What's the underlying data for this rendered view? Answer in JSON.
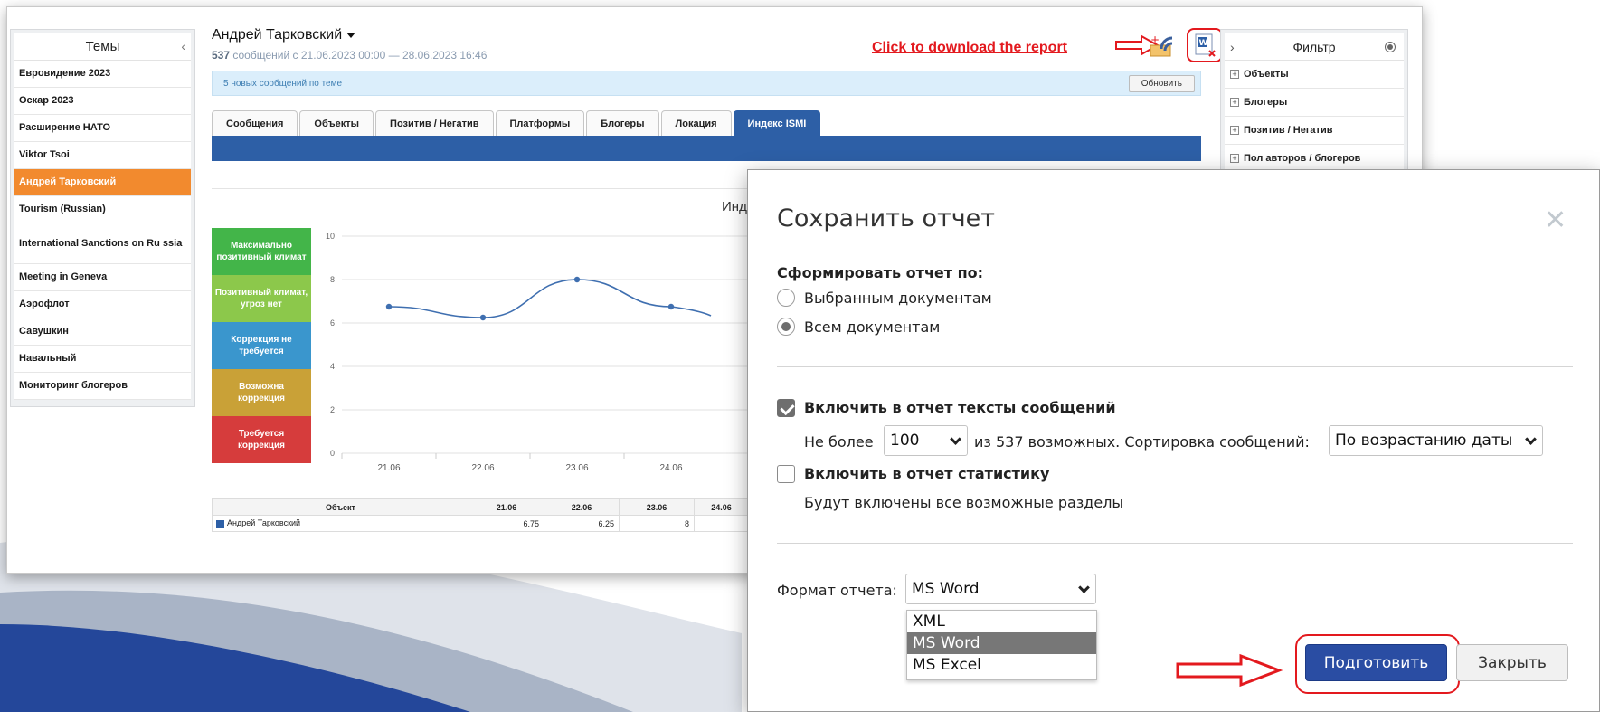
{
  "themes": {
    "title": "Темы",
    "items": [
      {
        "label": "Евровидение 2023"
      },
      {
        "label": "Оскар 2023"
      },
      {
        "label": "Расширение НАТО"
      },
      {
        "label": "Viktor Tsoi"
      },
      {
        "label": "Андрей Тарковский"
      },
      {
        "label": "Tourism (Russian)"
      },
      {
        "label": "International Sanctions on Ru ssia"
      },
      {
        "label": "Meeting in Geneva"
      },
      {
        "label": "Аэрофлот"
      },
      {
        "label": "Савушкин"
      },
      {
        "label": "Навальный"
      },
      {
        "label": "Мониторинг блогеров"
      }
    ]
  },
  "header": {
    "title": "Андрей Тарковский",
    "count": "537",
    "sub_prefix": "сообщений с",
    "date_range": "21.06.2023 00:00 — 28.06.2023 16:46",
    "download_annotation": "Click to download the report"
  },
  "notice": {
    "text": "5 новых сообщений по теме",
    "refresh_label": "Обновить"
  },
  "tabs": [
    {
      "label": "Сообщения"
    },
    {
      "label": "Объекты"
    },
    {
      "label": "Позитив / Негатив"
    },
    {
      "label": "Платформы"
    },
    {
      "label": "Блогеры"
    },
    {
      "label": "Локация"
    },
    {
      "label": "Индекс ISMI"
    }
  ],
  "chart_title_partial": "Инде",
  "legend": [
    {
      "label": "Максимально позитивный климат",
      "color": "#43b549"
    },
    {
      "label": "Позитивный климат, угроз нет",
      "color": "#8cc84b"
    },
    {
      "label": "Коррекция не требуется",
      "color": "#3a96cd"
    },
    {
      "label": "Возможна коррекция",
      "color": "#c9a137"
    },
    {
      "label": "Требуется коррекция",
      "color": "#d63c3c"
    }
  ],
  "chart_data": {
    "type": "line",
    "x": [
      "21.06",
      "22.06",
      "23.06",
      "24.06"
    ],
    "series": [
      {
        "name": "Андрей Тарковский",
        "values": [
          6.75,
          6.25,
          8,
          6.75
        ]
      }
    ],
    "ylim": [
      0,
      10
    ],
    "yticks": [
      "0",
      "2",
      "4",
      "6",
      "8",
      "10"
    ],
    "grid": true,
    "color": "#3f6fb0"
  },
  "table": {
    "headers": [
      "Объект",
      "21.06",
      "22.06",
      "23.06",
      "24.06"
    ],
    "rows": [
      {
        "object": "Андрей Тарковский",
        "values": [
          "6.75",
          "6.25",
          "8",
          ""
        ]
      }
    ]
  },
  "filter": {
    "title": "Фильтр",
    "items": [
      {
        "label": "Объекты"
      },
      {
        "label": "Блогеры"
      },
      {
        "label": "Позитив / Негатив"
      },
      {
        "label": "Пол авторов / блогеров"
      }
    ]
  },
  "modal": {
    "title": "Сохранить отчет",
    "form_label": "Сформировать отчет по:",
    "radio_selected_docs": "Выбранным документам",
    "radio_all_docs": "Всем документам",
    "include_texts_label": "Включить в отчет тексты сообщений",
    "limit_prefix": "Не более",
    "limit_value": "100",
    "limit_suffix": "из 537 возможных. Сортировка сообщений:",
    "sort_value": "По возрастанию даты",
    "include_stats_label": "Включить в отчет статистику",
    "stats_note": "Будут включены все возможные разделы",
    "format_label": "Формат отчета:",
    "format_value": "MS Word",
    "format_options": [
      "XML",
      "MS Word",
      "MS Excel"
    ],
    "prepare_label": "Подготовить",
    "close_label": "Закрыть"
  }
}
